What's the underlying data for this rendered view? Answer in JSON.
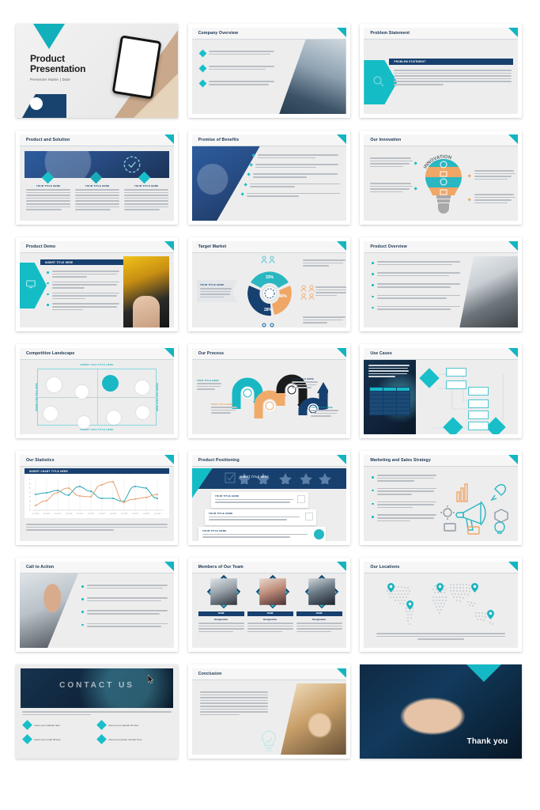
{
  "deck": {
    "title_slide": {
      "title_line1": "Product",
      "title_line2": "Presentation",
      "subtitle": "Presenter Name  |  Date"
    },
    "lorem_short": "Lorem ipsum dolor sit amet, consectetur adipiscing elit, sed do eiusmod tempor incididunt ut labore et dolore magna aliqua.",
    "lorem_long": "Lorem ipsum dolor sit amet, consectetur adipiscing elit, sed do eiusmod tempor incididunt ut labore et dolore magna aliqua. Ut enim ad minim veniam, quis nostrud exercitation ullamco laboris nisi ut aliquip ex ea commodo consequat. Duis aute irure dolor in reprehenderit in voluptate velit esse cillum dolore eu fugiat nulla pariatur.",
    "placeholder_title": "YOUR TITLE HERE",
    "insert_title": "INSERT TITLE HERE",
    "insert_chart_title": "INSERT CHART TITLE HERE",
    "slides": [
      {
        "n": 1,
        "title": "Product Presentation"
      },
      {
        "n": 2,
        "title": "Company Overview"
      },
      {
        "n": 3,
        "title": "Problem Statement",
        "band_label": "PROBLEM STATEMENT"
      },
      {
        "n": 4,
        "title": "Product and Solution"
      },
      {
        "n": 5,
        "title": "Promise of Benefits"
      },
      {
        "n": 6,
        "title": "Our Innovation",
        "wordmark": "INNOVATION"
      },
      {
        "n": 7,
        "title": "Product Demo",
        "band_label": "INSERT TITLE HERE"
      },
      {
        "n": 8,
        "title": "Target Market"
      },
      {
        "n": 9,
        "title": "Product Overview"
      },
      {
        "n": 10,
        "title": "Competitive Landscape"
      },
      {
        "n": 11,
        "title": "Our Process"
      },
      {
        "n": 12,
        "title": "Use Cases"
      },
      {
        "n": 13,
        "title": "Our Statistics"
      },
      {
        "n": 14,
        "title": "Product Positioning",
        "band_label": "INSERT TITLE HERE"
      },
      {
        "n": 15,
        "title": "Marketing and Sales Strategy"
      },
      {
        "n": 16,
        "title": "Call to Action"
      },
      {
        "n": 17,
        "title": "Members of Our Team"
      },
      {
        "n": 18,
        "title": "Our Locations"
      },
      {
        "n": 19,
        "title": "Contact Us",
        "heading": "CONTACT US"
      },
      {
        "n": 20,
        "title": "Conclusion"
      },
      {
        "n": 21,
        "title": "Thank you"
      }
    ],
    "innovation": {
      "left_items": [
        "Lorem ipsum dolor sit amet, consectetur adipiscing elit, sed do eiusmod tempor incididunt ut labore et dolore magna aliqua.",
        "Lorem ipsum dolor sit amet, consectetur adipiscing elit, sed do eiusmod tempor incididunt ut labore et dolore magna aliqua."
      ],
      "right_items": [
        "Lorem ipsum dolor sit amet, consectetur adipiscing elit, sed do eiusmod tempor incididunt ut labore et dolore magna aliqua.",
        "Lorem ipsum dolor sit amet, consectetur adipiscing elit, sed do eiusmod tempor incididunt ut labore et dolore magna aliqua."
      ]
    },
    "team": {
      "name_label": "NAME",
      "designation_label": "Designation",
      "members": [
        {
          "name": "NAME",
          "designation": "Designation"
        },
        {
          "name": "NAME",
          "designation": "Designation"
        },
        {
          "name": "NAME",
          "designation": "Designation"
        }
      ]
    },
    "contact": {
      "heading": "CONTACT US",
      "items": [
        "Insert your website here",
        "Insert your LinkedIn ID here",
        "Insert your email ID here",
        "Insert your phone number here"
      ]
    },
    "thank_you": {
      "text": "Thank you"
    },
    "matrix": {
      "top_label": "INSERT AXIS TITLE HERE",
      "bottom_label": "INSERT AXIS TITLE HERE",
      "left_label": "INSERT AXIS TITLE HERE",
      "right_label": "INSERT AXIS TITLE HERE",
      "bubbles": [
        "Lorem ipsum dolor",
        "Lorem ipsum dolor",
        "Lorem ipsum dolor",
        "Lorem ipsum dolor",
        "Lorem ipsum dolor",
        "Lorem ipsum dolor",
        "Lorem ipsum dolor",
        "Lorem ipsum dolor"
      ],
      "highlight_index": 2
    },
    "process": {
      "steps": [
        {
          "label": "YOUR TITLE HERE",
          "color": "#17b8c4"
        },
        {
          "label": "YOUR TITLE HERE",
          "color": "#f0ab6a"
        },
        {
          "label": "YOUR TITLE HERE",
          "color": "#1b1b1b"
        },
        {
          "label": "YOUR TITLE HERE",
          "color": "#16406f"
        }
      ]
    },
    "use_cases": {
      "table_headers": [
        "Text",
        "Text",
        "Text"
      ],
      "table_rows": [
        [
          "Text",
          "Text",
          "Text"
        ],
        [
          "Text",
          "Text",
          "Text"
        ],
        [
          "Text",
          "Text",
          "Text"
        ],
        [
          "Text",
          "Text",
          "Text"
        ],
        [
          "Text",
          "Text",
          "Text"
        ],
        [
          "Text",
          "Text",
          "Text"
        ]
      ],
      "node_label": "Lorem Ipsum Dolor"
    },
    "positioning": {
      "star_count": 5,
      "cards": [
        {
          "title": "YOUR TITLE HERE",
          "body": "Lorem ipsum dolor sit amet, consectetur adipiscing elit, sed do eiusmod tempor incididunt ut labore et dolore magna aliqua."
        },
        {
          "title": "YOUR TITLE HERE",
          "body": "Lorem ipsum dolor sit amet, consectetur adipiscing elit, sed do eiusmod tempor incididunt ut labore et dolore magna aliqua."
        },
        {
          "title": "YOUR TITLE HERE",
          "body": "Lorem ipsum dolor sit amet, consectetur adipiscing elit, sed do eiusmod tempor incididunt ut labore et dolore magna aliqua."
        }
      ]
    },
    "colors": {
      "teal": "#14bcc6",
      "navy": "#17406f",
      "dark_navy": "#16314f",
      "orange": "#f0ab6a",
      "slide_bg": "#ededed",
      "page_bg": "#ffffff"
    }
  },
  "chart_data": [
    {
      "type": "line",
      "title": "INSERT CHART TITLE HERE",
      "xlabel": "",
      "ylabel": "",
      "grid": true,
      "legend": "none",
      "x": [
        "Q1 2020",
        "Q2 2020",
        "Q3 2020",
        "Q4 2020",
        "Q1 2021",
        "Q2 2021",
        "Q3 2021",
        "Q4 2021",
        "Q1 2022",
        "Q2 2022",
        "Q3 2022",
        "Q4 2022"
      ],
      "ylim": [
        0,
        7
      ],
      "yticks": [
        0,
        1,
        2,
        3,
        4,
        5,
        6,
        7
      ],
      "series": [
        {
          "name": "Series 1",
          "color": "#2aa8b4",
          "values": [
            3.4,
            3.6,
            3.9,
            3.2,
            4.6,
            4.0,
            3.0,
            3.0,
            2.6,
            4.6,
            4.4,
            3.0
          ]
        },
        {
          "name": "Series 2",
          "color": "#e8a070",
          "values": [
            1.2,
            2.0,
            3.3,
            4.2,
            3.2,
            3.1,
            5.0,
            5.6,
            2.2,
            2.8,
            3.1,
            3.5
          ]
        }
      ]
    },
    {
      "type": "pie",
      "title": "Target Market",
      "labels": [
        "33%",
        "40%",
        "28%"
      ],
      "values": [
        33,
        40,
        28
      ],
      "colors": [
        "#2ab7c2",
        "#efa666",
        "#16406f"
      ],
      "donut": true
    }
  ]
}
